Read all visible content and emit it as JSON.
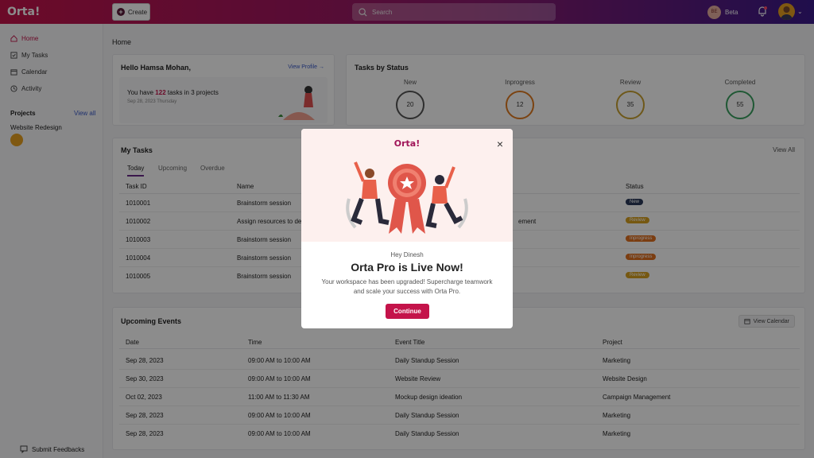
{
  "app": {
    "logo": "Orta!",
    "create_label": "Create",
    "search_placeholder": "Search",
    "beta_initials": "BE",
    "beta_label": "Beta"
  },
  "sidebar": {
    "items": [
      {
        "label": "Home",
        "icon": "home-icon"
      },
      {
        "label": "My Tasks",
        "icon": "tasks-icon"
      },
      {
        "label": "Calendar",
        "icon": "calendar-icon"
      },
      {
        "label": "Activity",
        "icon": "activity-icon"
      }
    ],
    "projects_heading": "Projects",
    "view_all": "View all",
    "project_name": "Website Redesign",
    "submit_feedback": "Submit Feedbacks"
  },
  "main": {
    "title": "Home"
  },
  "hello": {
    "greeting": "Hello Hamsa Mohan,",
    "view_profile": "View Profile →",
    "tasks_prefix": "You have ",
    "task_count": "122",
    "tasks_suffix": " tasks in 3 projects",
    "date": "Sep 28, 2023 Thursday"
  },
  "status": {
    "title": "Tasks by Status",
    "items": [
      {
        "label": "New",
        "value": "20",
        "color": "#555555"
      },
      {
        "label": "Inprogress",
        "value": "12",
        "color": "#e07a20"
      },
      {
        "label": "Review",
        "value": "35",
        "color": "#c8a030"
      },
      {
        "label": "Completed",
        "value": "55",
        "color": "#3aa060"
      }
    ]
  },
  "tasks": {
    "title": "My Tasks",
    "view_all": "View All",
    "tabs": [
      "Today",
      "Upcoming",
      "Overdue"
    ],
    "headers": {
      "id": "Task ID",
      "name": "Name",
      "status": "Status"
    },
    "rows": [
      {
        "id": "1010001",
        "name": "Brainstorm session",
        "extra": "",
        "status": "New",
        "color": "#2a3a5a"
      },
      {
        "id": "1010002",
        "name": "Assign resources to des",
        "extra": "ement",
        "status": "Review",
        "color": "#d8a020"
      },
      {
        "id": "1010003",
        "name": "Brainstorm session",
        "extra": "",
        "status": "Inprogress",
        "color": "#e07020"
      },
      {
        "id": "1010004",
        "name": "Brainstorm session",
        "extra": "",
        "status": "Inprogress",
        "color": "#e07020"
      },
      {
        "id": "1010005",
        "name": "Brainstorm session",
        "extra": "",
        "status": "Review",
        "color": "#d8a020"
      }
    ]
  },
  "events": {
    "title": "Upcoming Events",
    "view_calendar": "View Calendar",
    "headers": {
      "date": "Date",
      "time": "Time",
      "title": "Event Title",
      "project": "Project"
    },
    "rows": [
      {
        "date": "Sep 28, 2023",
        "time": "09:00 AM to 10:00 AM",
        "title": "Daily Standup Session",
        "project": "Marketing"
      },
      {
        "date": "Sep 30, 2023",
        "time": "09:00 AM to 10:00 AM",
        "title": "Website Review",
        "project": "Website Design"
      },
      {
        "date": "Oct 02, 2023",
        "time": "11:00 AM to 11:30 AM",
        "title": "Mockup design ideation",
        "project": "Campaign Management"
      },
      {
        "date": "Sep 28, 2023",
        "time": "09:00 AM to 10:00 AM",
        "title": "Daily Standup Session",
        "project": "Marketing"
      },
      {
        "date": "Sep 28, 2023",
        "time": "09:00 AM to 10:00 AM",
        "title": "Daily Standup Session",
        "project": "Marketing"
      }
    ]
  },
  "modal": {
    "logo": "Orta!",
    "hey": "Hey Dinesh",
    "title": "Orta Pro is Live Now!",
    "description": "Your workspace has been upgraded! Supercharge teamwork and scale your success with Orta Pro.",
    "continue": "Continue"
  }
}
